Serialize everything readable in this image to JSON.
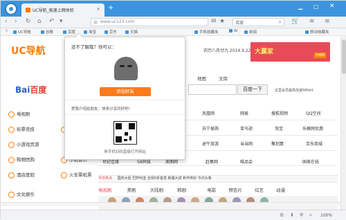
{
  "browser": {
    "tab_title": "UC导航_极速上网体验",
    "tab_close": "×",
    "new_tab": "+",
    "address": "www.uc123.com",
    "search_engine": "百度",
    "zoom": "100%"
  },
  "bookmarks": [
    "UC导航",
    "谷歌",
    "百度",
    "淘宝",
    "京东",
    "天猫",
    "手机收藏夹",
    "AI",
    "新闻",
    "移动收藏夹"
  ],
  "page": {
    "logo": "UC导航",
    "date": "农历八月廿九 2014.9.22 周一",
    "promo_text": "大赢家",
    "promo_tag": "¥488",
    "baidu_logo_a": "Bai",
    "baidu_logo_b": "百度",
    "tabs_right": [
      "地图",
      "文库"
    ],
    "baidu_button": "百度一下",
    "baidu_link": "这里会员最高加速5M/bit"
  },
  "categories_left": [
    {
      "label": "电视剧"
    },
    {
      "label": "彩票竞技"
    },
    {
      "label": "小游戏页游"
    },
    {
      "label": "购物团购"
    },
    {
      "label": "酒店度假"
    },
    {
      "label": "文化娱乐"
    }
  ],
  "categories_mid": [
    {
      "label": "小说"
    },
    {
      "label": "小说音乐"
    },
    {
      "label": "火车票机票"
    }
  ],
  "sites": [
    [
      "凤凰网",
      "网易",
      "搜狐视频",
      "QQ空间"
    ],
    [
      "苏宁易购",
      "亚马逊",
      "淘宝",
      "乐蜂网优惠"
    ],
    [
      "途牛旅游",
      "当当网",
      "聚划算",
      "京东商城"
    ],
    [
      "美图网",
      "赶集网",
      "唯品会",
      "国美在线"
    ]
  ],
  "sites_left": [
    "世纪佳缘",
    "58同城"
  ],
  "news_strip": {
    "hot": "今日热点",
    "items": "国庆大促  巴萨利亚  全场5折首发  新疆大讲  新作传好  今日头条"
  },
  "video_tabs": [
    "电视剧",
    "美剧",
    "大陆剧",
    "韩剧",
    "电影",
    "预告片",
    "综艺",
    "动漫"
  ],
  "popup": {
    "title": "还不了解我？你可以：",
    "button": "添加好友",
    "desc": "把我介绍给朋友，快来分享同好吧！",
    "qr_caption": "用手机扫码直接打开网站"
  },
  "colors": {
    "accent": "#3c94dc",
    "orange": "#ff7a1a",
    "red": "#e84b57"
  }
}
